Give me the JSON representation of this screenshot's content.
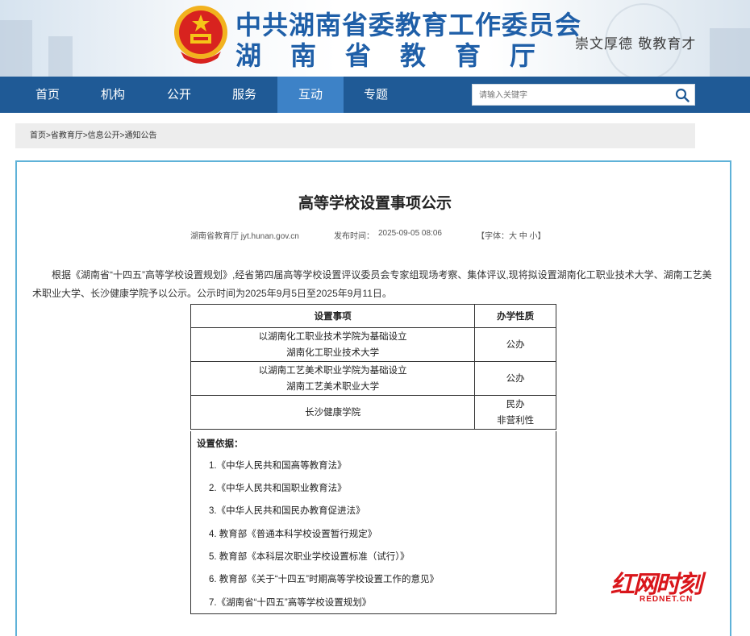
{
  "header": {
    "title_line1": "中共湖南省委教育工作委员会",
    "title_line2": "湖南省教育厅",
    "motto": "崇文厚德  敬教育才"
  },
  "nav": {
    "items": [
      {
        "label": "首页"
      },
      {
        "label": "机构"
      },
      {
        "label": "公开"
      },
      {
        "label": "服务"
      },
      {
        "label": "互动",
        "active": true
      },
      {
        "label": "专题"
      }
    ],
    "accent": "#1f5a96",
    "active_color": "#3d82c7"
  },
  "search": {
    "placeholder": "请输入关键字",
    "icon": "search-icon"
  },
  "breadcrumb": "首页>省教育厅>信息公开>通知公告",
  "article": {
    "title": "高等学校设置事项公示",
    "source": "湖南省教育厅 jyt.hunan.gov.cn",
    "publish_label": "发布时间：",
    "publish_time": "2025-09-05 08:06",
    "font_size_label": "【字体：大 中 小】",
    "paragraph": "根据《湖南省“十四五”高等学校设置规划》,经省第四届高等学校设置评议委员会专家组现场考察、集体评议,现将拟设置湖南化工职业技术大学、湖南工艺美术职业大学、长沙健康学院予以公示。公示时间为2025年9月5日至2025年9月11日。"
  },
  "table": {
    "headers": [
      "设置事项",
      "办学性质"
    ],
    "rows": [
      {
        "item_line1": "以湖南化工职业技术学院为基础设立",
        "item_line2": "湖南化工职业技术大学",
        "nature_line1": "公办",
        "nature_line2": ""
      },
      {
        "item_line1": "以湖南工艺美术职业学院为基础设立",
        "item_line2": "湖南工艺美术职业大学",
        "nature_line1": "公办",
        "nature_line2": ""
      },
      {
        "item_line1": "长沙健康学院",
        "item_line2": "",
        "nature_line1": "民办",
        "nature_line2": "非营利性"
      }
    ],
    "basis_title": "设置依据：",
    "basis_items": [
      "1.《中华人民共和国高等教育法》",
      "2.《中华人民共和国职业教育法》",
      "3.《中华人民共和国民办教育促进法》",
      "4. 教育部《普通本科学校设置暂行规定》",
      "5. 教育部《本科层次职业学校设置标准（试行）》",
      "6. 教育部《关于“十四五”时期高等学校设置工作的意见》",
      "7.《湖南省“十四五”高等学校设置规划》"
    ]
  },
  "watermark": {
    "text": "红网时刻",
    "sub": "REDNET.CN",
    "color": "#d9161b"
  }
}
